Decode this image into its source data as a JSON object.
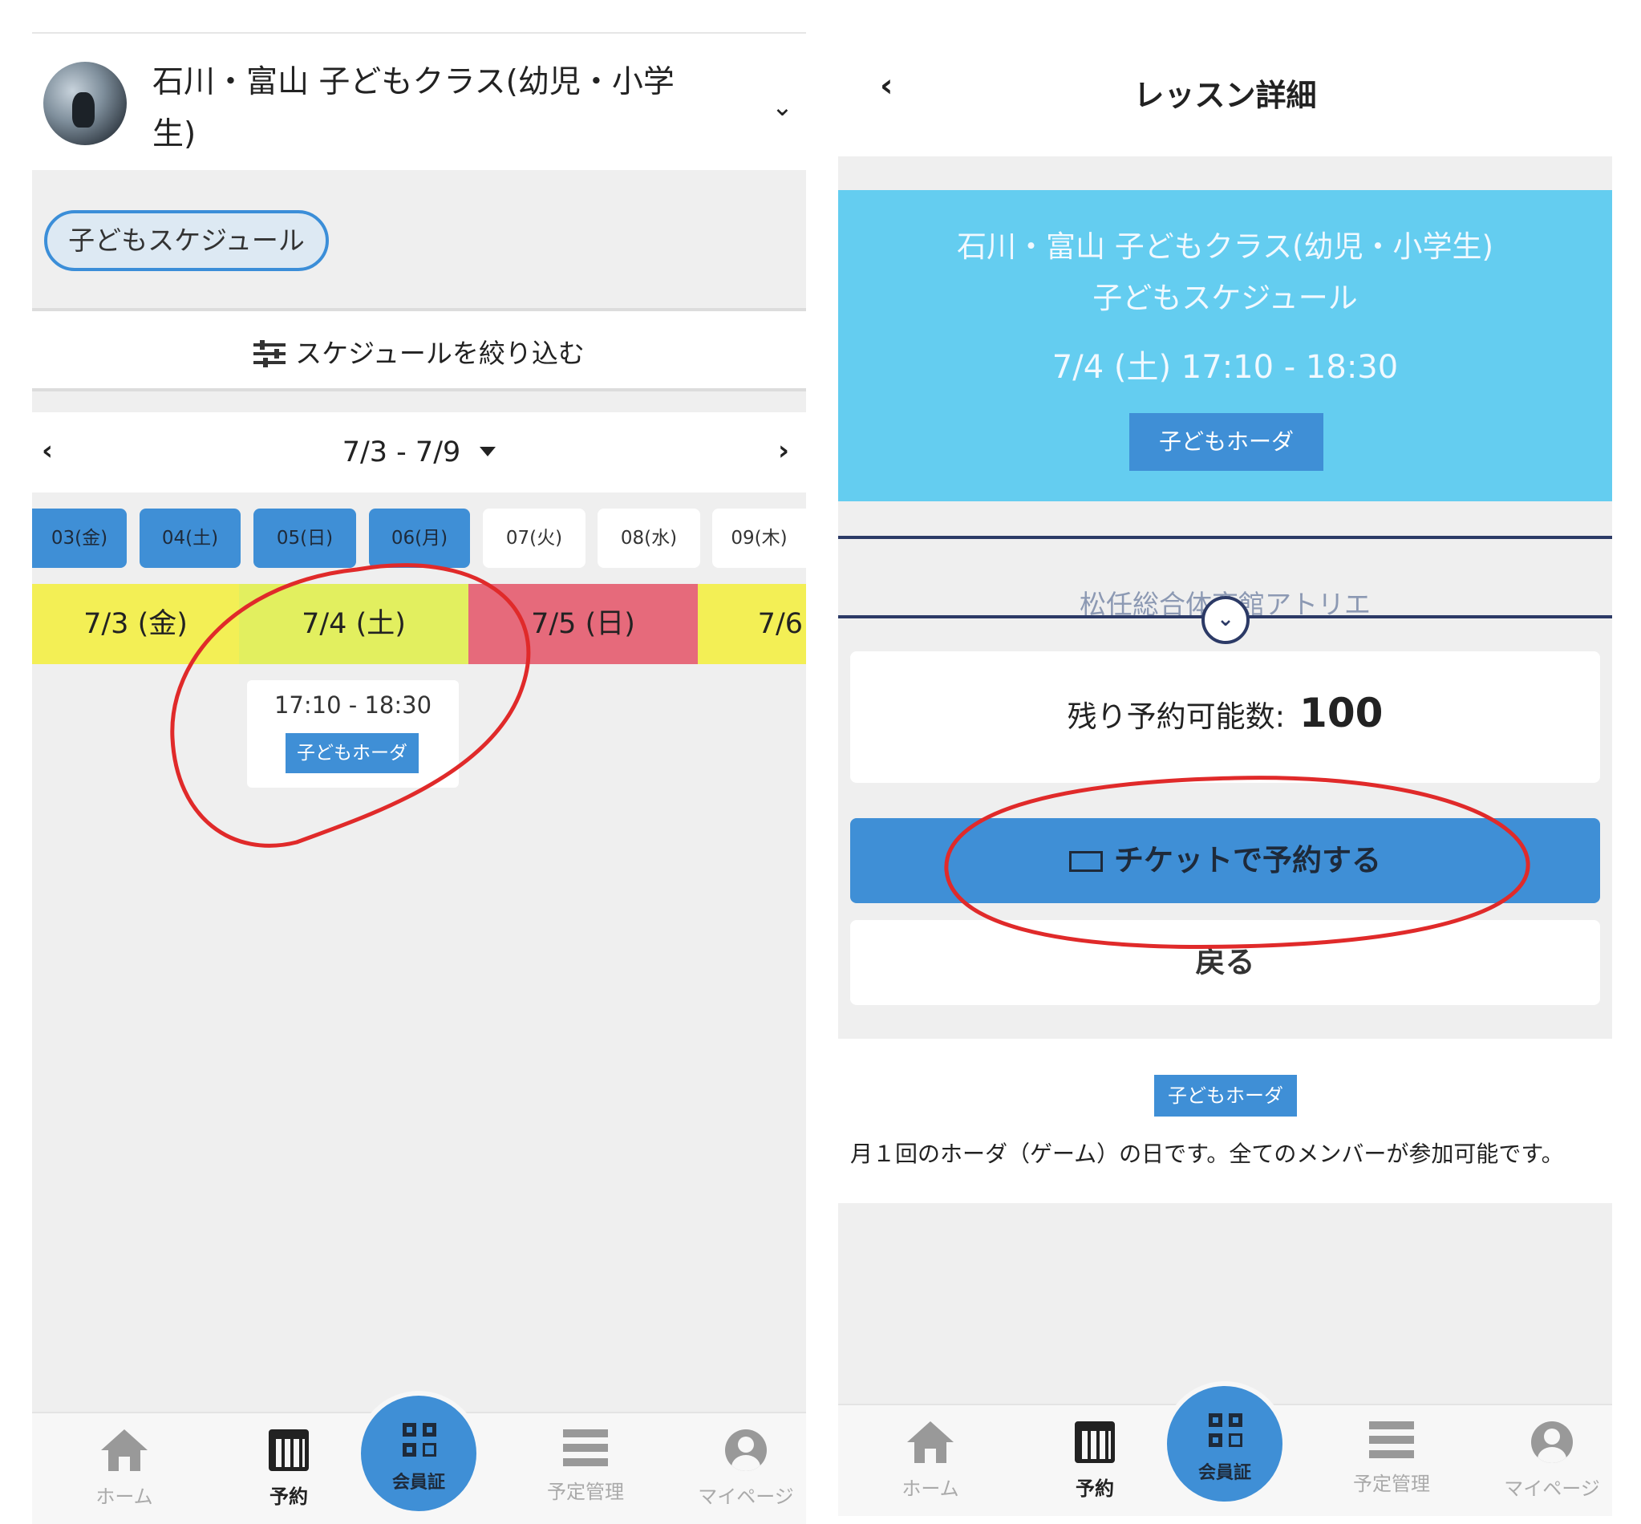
{
  "left": {
    "header": {
      "title": "石川・富山 子どもクラス(幼児・小学生)"
    },
    "schedule_pill": "子どもスケジュール",
    "filter_label": "スケジュールを絞り込む",
    "week_range": "7/3 - 7/9",
    "days": [
      "03(金)",
      "04(土)",
      "05(日)",
      "06(月)",
      "07(火)",
      "08(水)",
      "09(木)"
    ],
    "columns": [
      "7/3 (金)",
      "7/4 (土)",
      "7/5 (日)",
      "7/6"
    ],
    "column_colors": [
      "#f3ef55",
      "#e2ef5f",
      "#e66a7b",
      "#f3ef55"
    ],
    "slot": {
      "time": "17:10 - 18:30",
      "tag": "子どもホーダ"
    }
  },
  "right": {
    "title": "レッスン詳細",
    "banner": {
      "class_name": "石川・富山 子どもクラス(幼児・小学生)",
      "schedule": "子どもスケジュール",
      "datetime": "7/4 (土) 17:10 - 18:30",
      "tag": "子どもホーダ"
    },
    "venue": "松任総合体育館アトリエ",
    "remaining_label": "残り予約可能数:",
    "remaining_value": "100",
    "book_button": "チケットで予約する",
    "back_button": "戻る",
    "tag": "子どもホーダ",
    "description": "月１回のホーダ（ゲーム）の日です。全てのメンバーが参加可能です。"
  },
  "nav": {
    "home": "ホーム",
    "reserve": "予約",
    "member_card": "会員証",
    "schedule_mgmt": "予定管理",
    "mypage": "マイページ"
  },
  "colors": {
    "accent": "#3f8fd6",
    "banner": "#64cdf0",
    "annotation": "#e02a2a"
  }
}
